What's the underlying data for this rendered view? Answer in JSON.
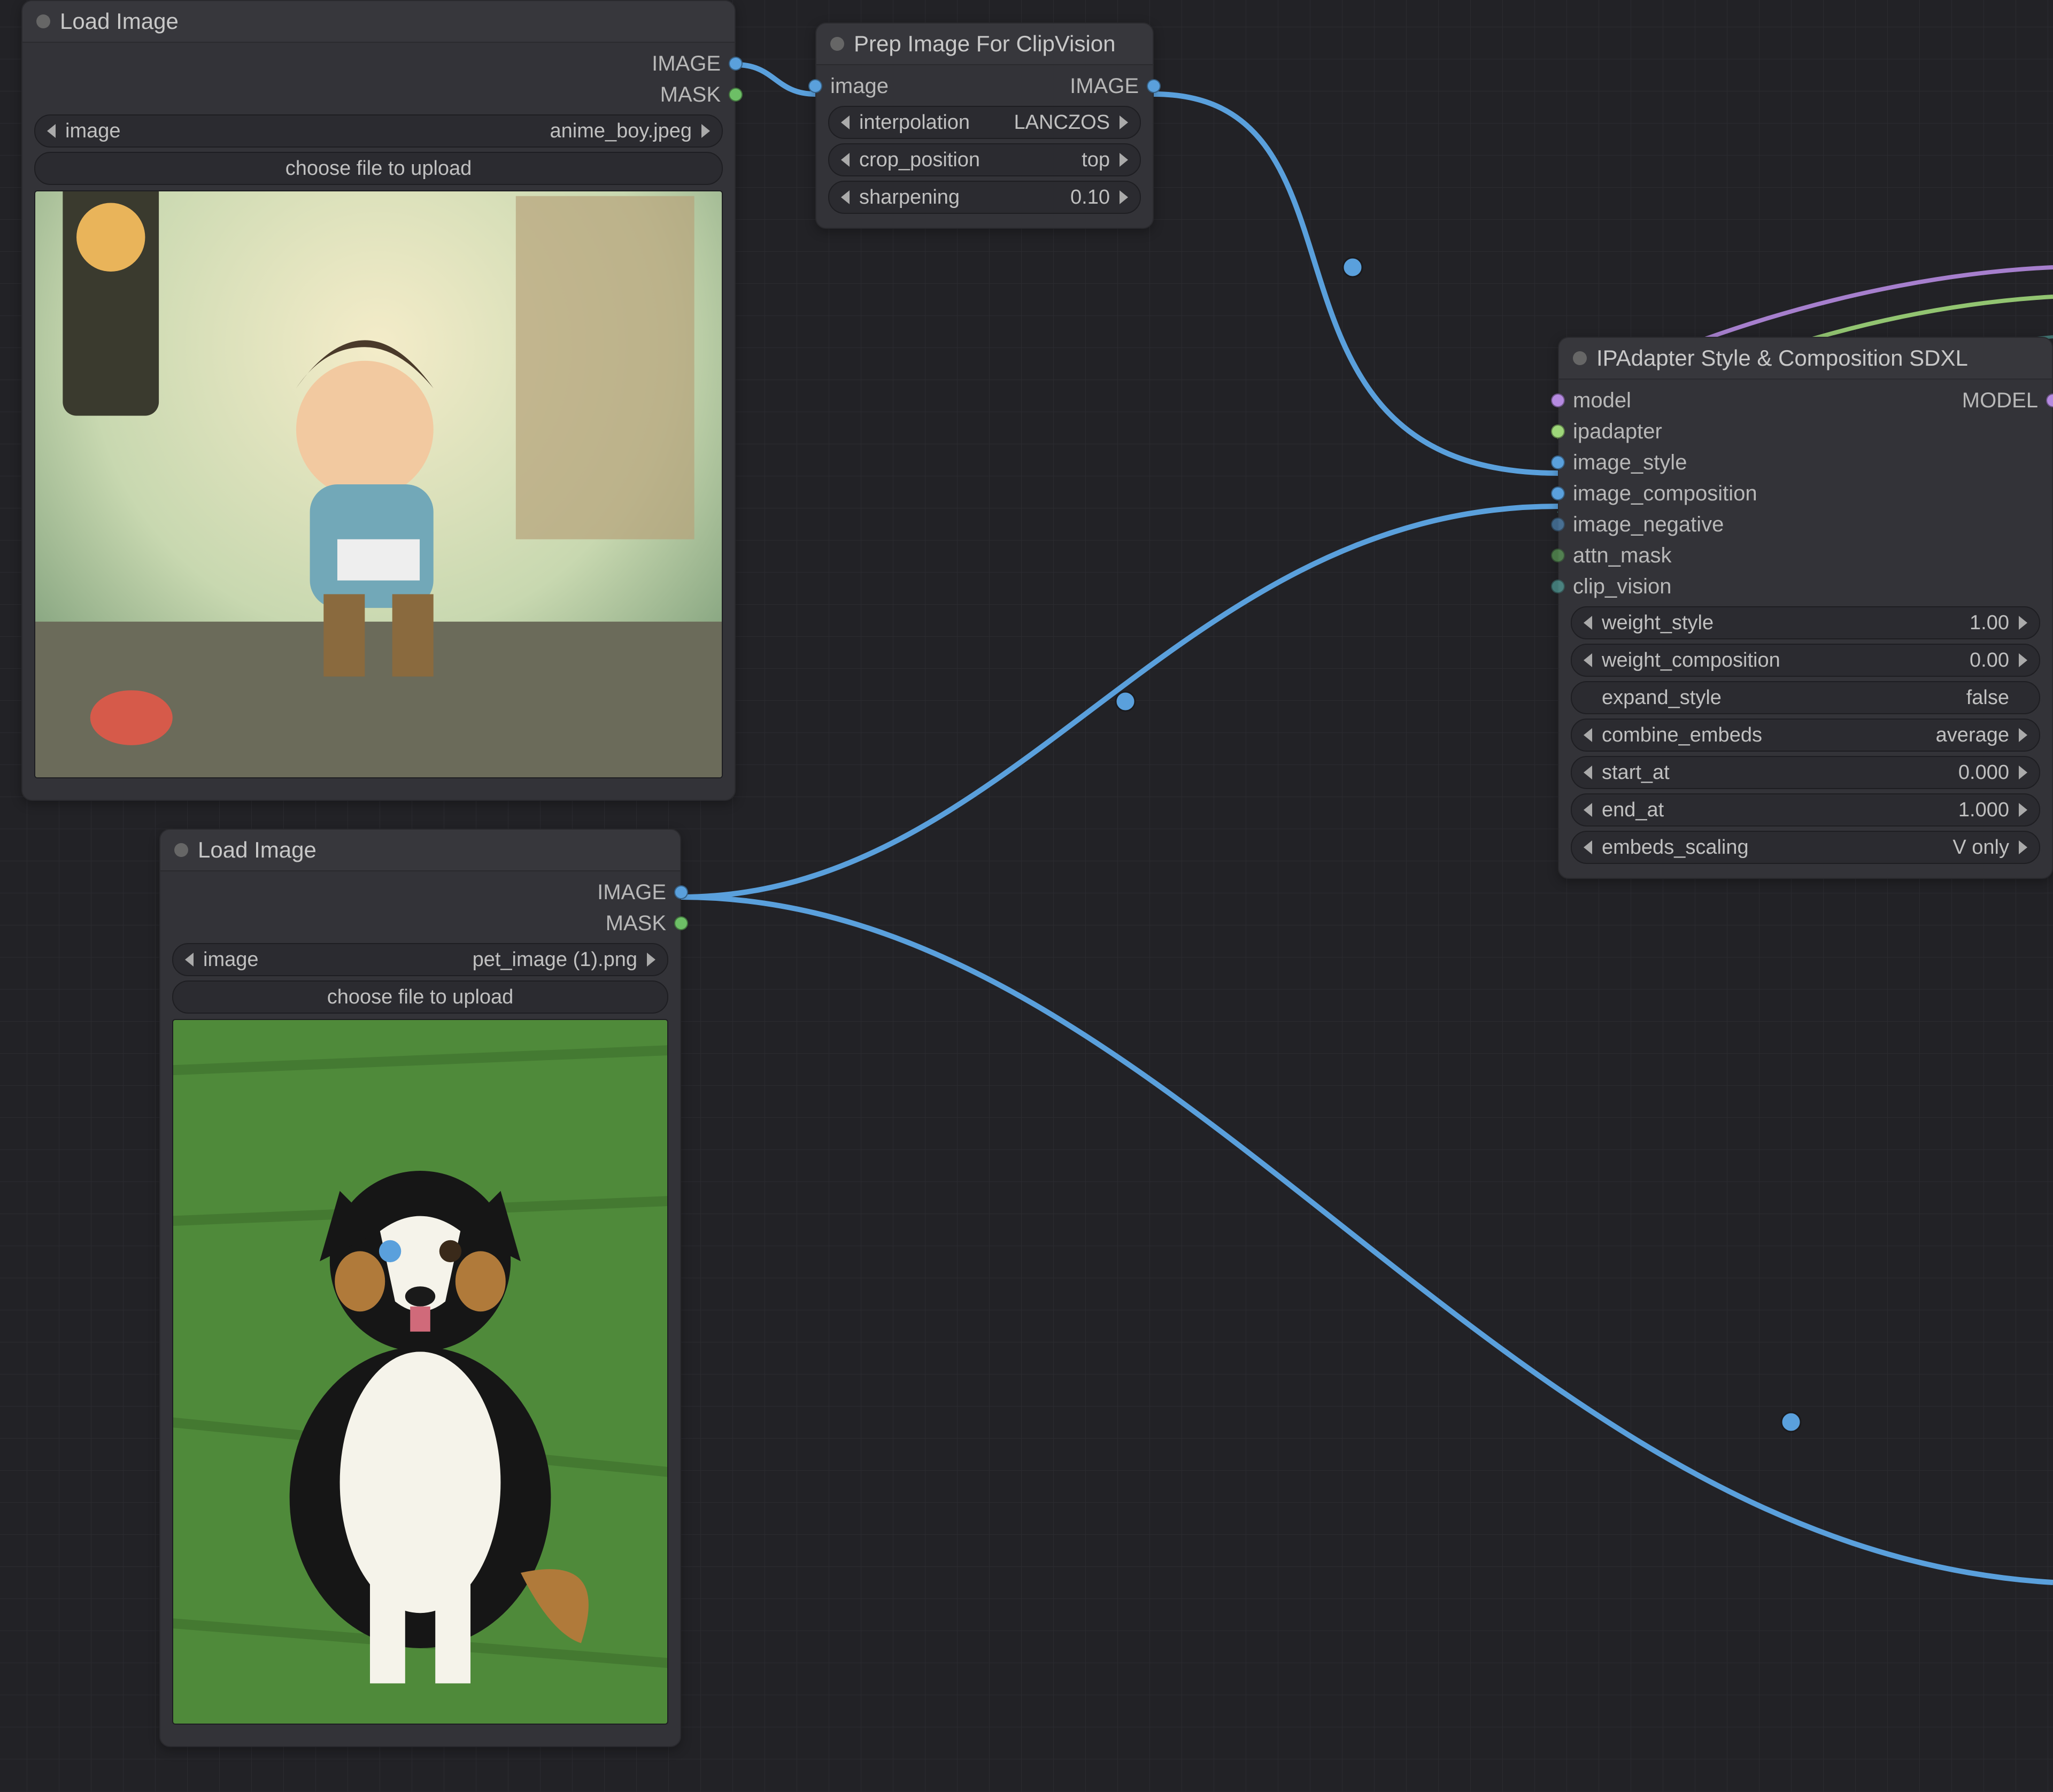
{
  "nodes": {
    "load1": {
      "title": "Load Image",
      "outputs": {
        "image": "IMAGE",
        "mask": "MASK"
      },
      "widgets": {
        "image_label": "image",
        "image_value": "anime_boy.jpeg",
        "upload_label": "choose file to upload"
      }
    },
    "load2": {
      "title": "Load Image",
      "outputs": {
        "image": "IMAGE",
        "mask": "MASK"
      },
      "widgets": {
        "image_label": "image",
        "image_value": "pet_image (1).png",
        "upload_label": "choose file to upload"
      }
    },
    "prep": {
      "title": "Prep Image For ClipVision",
      "inputs": {
        "image": "image"
      },
      "outputs": {
        "image": "IMAGE"
      },
      "widgets": {
        "interpolation_label": "interpolation",
        "interpolation_value": "LANCZOS",
        "crop_label": "crop_position",
        "crop_value": "top",
        "sharpening_label": "sharpening",
        "sharpening_value": "0.10"
      }
    },
    "ipa": {
      "title": "IPAdapter Style & Composition SDXL",
      "inputs": {
        "model": "model",
        "ipadapter": "ipadapter",
        "image_style": "image_style",
        "image_composition": "image_composition",
        "image_negative": "image_negative",
        "attn_mask": "attn_mask",
        "clip_vision": "clip_vision"
      },
      "outputs": {
        "model": "MODEL"
      },
      "widgets": {
        "weight_style_label": "weight_style",
        "weight_style_value": "1.00",
        "weight_comp_label": "weight_composition",
        "weight_comp_value": "0.00",
        "expand_style_label": "expand_style",
        "expand_style_value": "false",
        "combine_label": "combine_embeds",
        "combine_value": "average",
        "start_at_label": "start_at",
        "start_at_value": "0.000",
        "end_at_label": "end_at",
        "end_at_value": "1.000",
        "embeds_scaling_label": "embeds_scaling",
        "embeds_scaling_value": "V only"
      }
    }
  }
}
